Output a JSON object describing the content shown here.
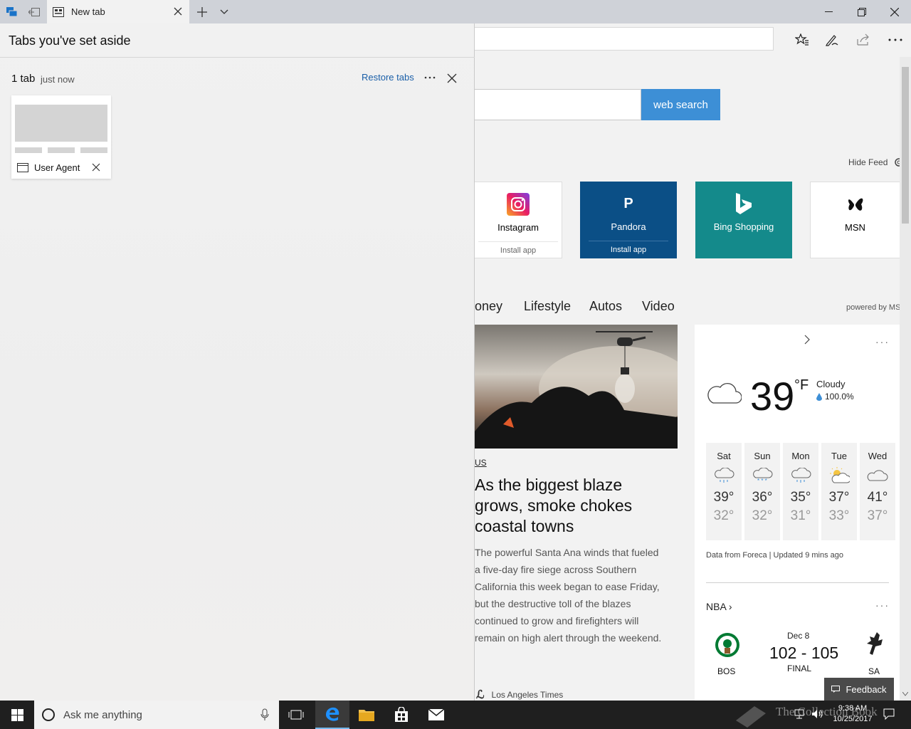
{
  "browser": {
    "tab_title": "New tab",
    "colors": {
      "accent": "#3d8fd6",
      "link": "#1a5fa8"
    }
  },
  "aside_panel": {
    "title": "Tabs you've set aside",
    "group": {
      "count": "1 tab",
      "time": "just now",
      "restore_label": "Restore tabs",
      "tabs": [
        {
          "title": "User Agent"
        }
      ]
    }
  },
  "newtab": {
    "search_button": "web search",
    "hide_feed": "Hide Feed",
    "tiles": [
      {
        "name": "Instagram",
        "sub": "Install app",
        "icon": "instagram-icon"
      },
      {
        "name": "Pandora",
        "sub": "Install app",
        "icon": "pandora-icon",
        "glyph": "P"
      },
      {
        "name": "Bing Shopping",
        "sub": "",
        "icon": "bing-icon"
      },
      {
        "name": "MSN",
        "sub": "",
        "icon": "msn-butterfly-icon"
      }
    ],
    "categories": [
      "oney",
      "Lifestyle",
      "Autos",
      "Video"
    ],
    "powered_by": "powered by MS",
    "news": {
      "tag": "US",
      "headline": "As the biggest blaze grows, smoke chokes coastal towns",
      "body": "The powerful Santa Ana winds that fueled a five-day fire siege across Southern California this week began to ease Friday, but the destructive toll of the blazes continued to grow and firefighters will remain on high alert through the weekend.",
      "source": "Los Angeles Times"
    },
    "weather": {
      "temp": "39",
      "unit": "°F",
      "condition": "Cloudy",
      "precip": "100.0%",
      "days": [
        {
          "name": "Sat",
          "hi": "39°",
          "lo": "32°",
          "icon": "snow-rain-icon"
        },
        {
          "name": "Sun",
          "hi": "36°",
          "lo": "32°",
          "icon": "snow-icon"
        },
        {
          "name": "Mon",
          "hi": "35°",
          "lo": "31°",
          "icon": "snow-rain-icon"
        },
        {
          "name": "Tue",
          "hi": "37°",
          "lo": "33°",
          "icon": "partly-sunny-icon"
        },
        {
          "name": "Wed",
          "hi": "41°",
          "lo": "37°",
          "icon": "cloudy-icon"
        }
      ],
      "data_source": "Data from Foreca | Updated 9 mins ago"
    },
    "nba": {
      "title": "NBA",
      "game": {
        "date": "Dec 8",
        "score": "102 - 105",
        "status": "FINAL",
        "home": "BOS",
        "away": "SA"
      }
    },
    "feedback": "Feedback"
  },
  "taskbar": {
    "search_placeholder": "Ask me anything",
    "time": "9:38 AM",
    "date": "10/25/2017",
    "watermark": "The Collection Book"
  }
}
